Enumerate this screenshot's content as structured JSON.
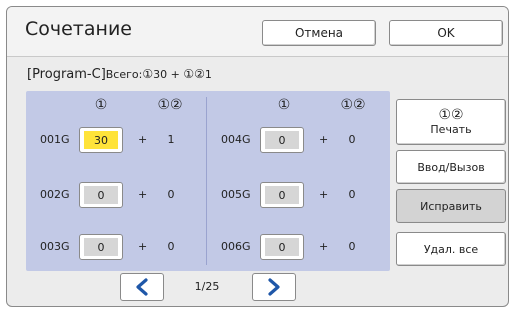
{
  "header": {
    "title": "Сочетание",
    "cancel_label": "Отмена",
    "ok_label": "OK"
  },
  "summary": {
    "program": "[Program-C]",
    "total_label": "Всего:",
    "single_symbol": "①",
    "single_value": "30",
    "plus": " + ",
    "pair_symbol": "①②",
    "pair_value": "1"
  },
  "grid": {
    "left_headers": [
      "①",
      "①②"
    ],
    "right_headers": [
      "①",
      "①②"
    ],
    "rows_left": [
      {
        "label": "001G",
        "value": "30",
        "count": "1",
        "active": true
      },
      {
        "label": "002G",
        "value": "0",
        "count": "0",
        "active": false
      },
      {
        "label": "003G",
        "value": "0",
        "count": "0",
        "active": false
      }
    ],
    "rows_right": [
      {
        "label": "004G",
        "value": "0",
        "count": "0",
        "active": false
      },
      {
        "label": "005G",
        "value": "0",
        "count": "0",
        "active": false
      },
      {
        "label": "006G",
        "value": "0",
        "count": "0",
        "active": false
      }
    ],
    "plus": "+"
  },
  "side": {
    "print_symbol": "①②",
    "print_label": "Печать",
    "input_label": "Ввод/Вызов",
    "edit_label": "Исправить",
    "delete_label": "Удал. все"
  },
  "pager": {
    "page": "1/25",
    "prev_icon": "chevron-left-icon",
    "next_icon": "chevron-right-icon"
  },
  "colors": {
    "accent": "#1f57a8",
    "panel": "#c2c9e6",
    "active_field": "#ffe33a"
  }
}
